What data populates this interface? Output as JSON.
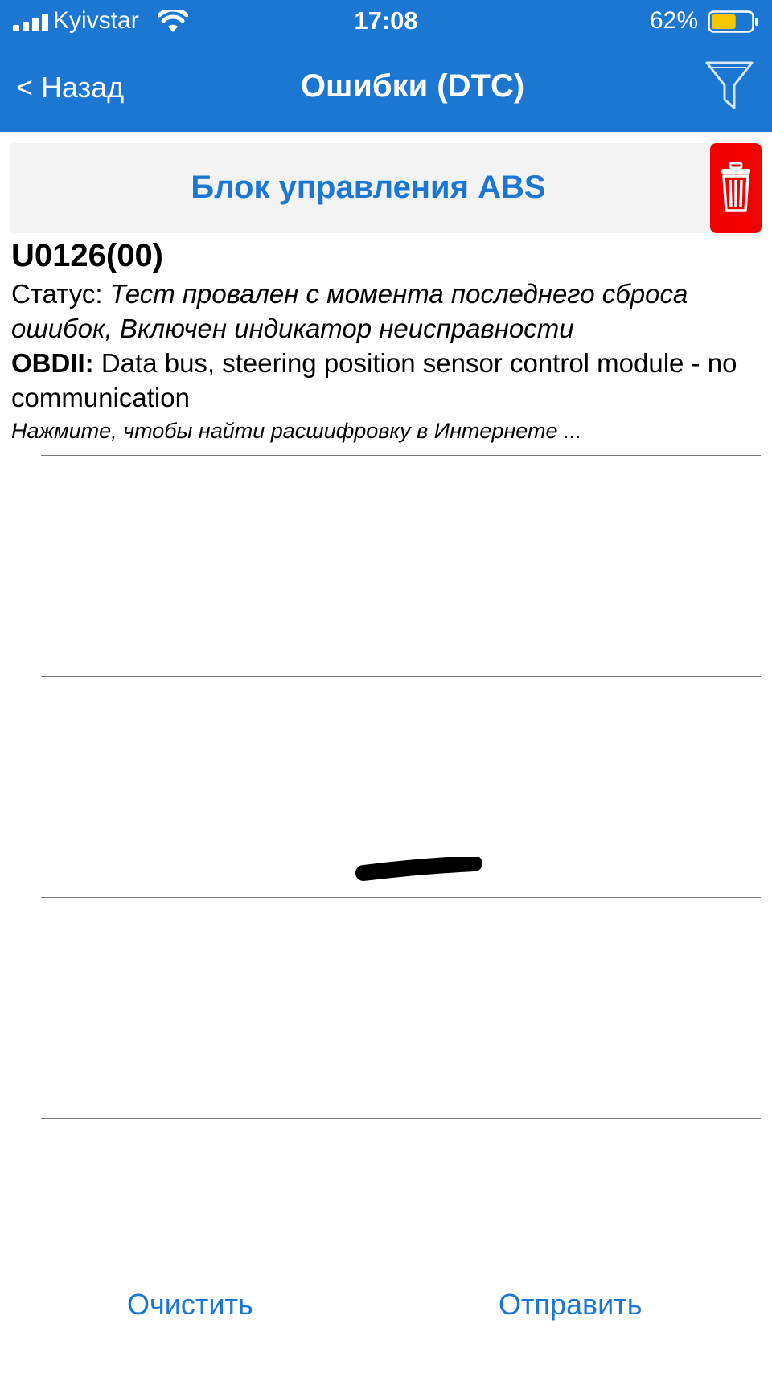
{
  "status_bar": {
    "carrier": "Kyivstar",
    "time": "17:08",
    "battery_percent": "62%",
    "battery_level": 0.62,
    "battery_color": "#f7c600"
  },
  "nav": {
    "back_label": "< Назад",
    "title": "Ошибки (DTC)",
    "filter_icon": "filter-icon"
  },
  "module": {
    "title": "Блок управления ABS",
    "delete_icon": "trash-icon"
  },
  "dtc": {
    "code": "U0126(00)",
    "status_label": "Статус:",
    "status_value": "Тест провален с момента последнего сброса ошибок, Включен индикатор неисправности",
    "obd_label": "OBDII:",
    "obd_value": "Data bus, steering position sensor control module - no communication",
    "hint": "Нажмите, чтобы найти расшифровку в Интернете ..."
  },
  "footer": {
    "clear_label": "Очистить",
    "send_label": "Отправить"
  },
  "colors": {
    "header": "#1b77d2",
    "accent": "#1b77d2",
    "delete": "#f20000",
    "module_bg": "#f3f3f3"
  }
}
